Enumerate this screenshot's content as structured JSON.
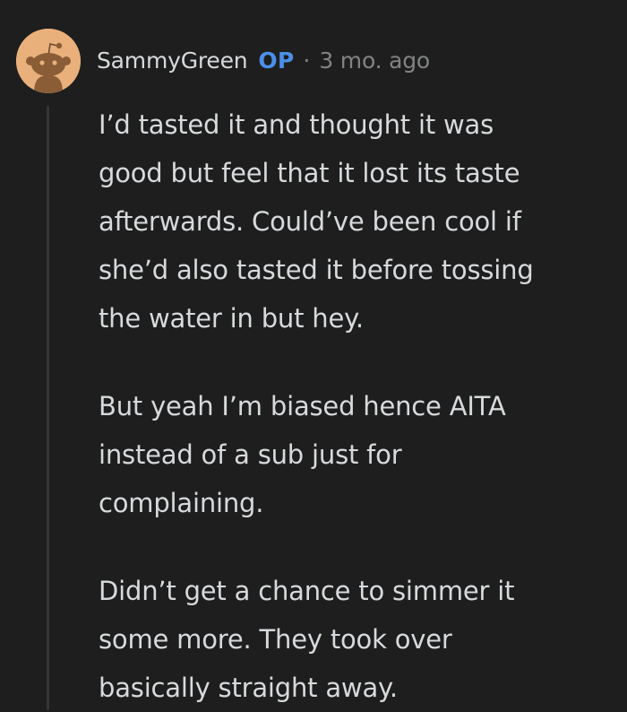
{
  "comment": {
    "author": "SammyGreen",
    "op_badge": "OP",
    "separator": "·",
    "timestamp": "3 mo. ago",
    "avatar_icon": "reddit-snoo-avatar",
    "paragraphs": [
      {
        "lines": [
          "I’d tasted it and thought it was",
          "good but feel that it lost its taste",
          "afterwards. Could’ve been cool if",
          "she’d also tasted it before tossing",
          "the water in but hey."
        ]
      },
      {
        "lines": [
          "But yeah I’m biased hence AITA",
          "instead of a sub just for",
          "complaining."
        ]
      },
      {
        "lines": [
          "Didn’t get a chance to simmer it",
          "some more. They took over",
          "basically straight away."
        ]
      }
    ]
  },
  "colors": {
    "background": "#1e1e1e",
    "text": "#d7dadc",
    "muted": "#818384",
    "op_accent": "#4a8fe7",
    "avatar_bg": "#eab07b",
    "thread_line": "#343536"
  }
}
